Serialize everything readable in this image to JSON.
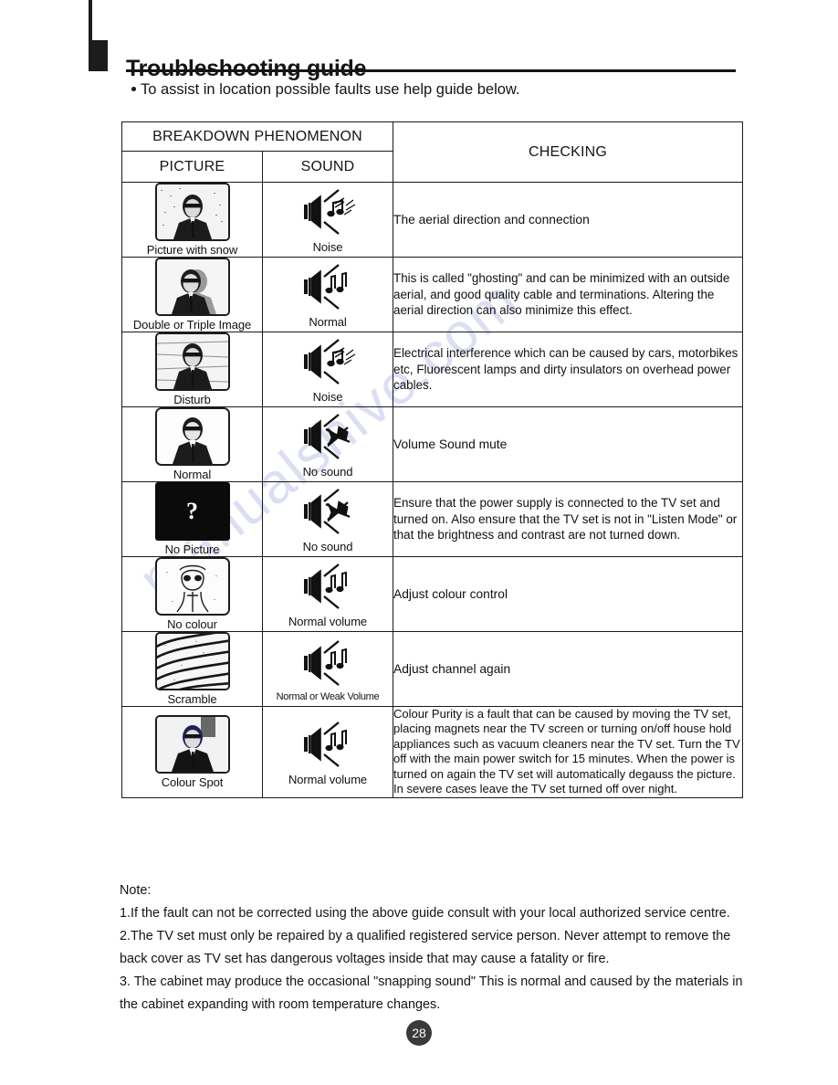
{
  "page": {
    "title": "Troubleshooting guide",
    "intro": "To assist in location possible faults use help guide below.",
    "number": "28",
    "watermark": "manualshive.com"
  },
  "table": {
    "group_header": "BREAKDOWN PHENOMENON",
    "columns": {
      "picture": "PICTURE",
      "sound": "SOUND",
      "checking": "CHECKING"
    },
    "rows": [
      {
        "picture_icon": "tv-snow-icon",
        "picture_label": "Picture with snow",
        "sound_icon": "speaker-noise-icon",
        "sound_label": "Noise",
        "checking": "The aerial direction and connection"
      },
      {
        "picture_icon": "tv-ghosting-icon",
        "picture_label": "Double or Triple Image",
        "sound_icon": "speaker-normal-icon",
        "sound_label": "Normal",
        "checking": "This is called \"ghosting\" and can be minimized with an outside aerial, and good quality cable and terminations.  Altering the aerial direction can also minimize this effect."
      },
      {
        "picture_icon": "tv-disturb-icon",
        "picture_label": "Disturb",
        "sound_icon": "speaker-noise-icon",
        "sound_label": "Noise",
        "checking": "Electrical interference which can be caused by cars, motorbikes etc, Fluorescent lamps and dirty insulators on overhead power cables."
      },
      {
        "picture_icon": "tv-normal-icon",
        "picture_label": "Normal",
        "sound_icon": "speaker-mute-icon",
        "sound_label": "No sound",
        "checking": "Volume Sound mute"
      },
      {
        "picture_icon": "tv-no-picture-icon",
        "picture_label": "No Picture",
        "sound_icon": "speaker-mute-icon",
        "sound_label": "No sound",
        "checking": "Ensure that the power supply is connected to the TV set and turned on. Also ensure that the TV set is not  in \"Listen Mode\" or that the  brightness and contrast are not turned down."
      },
      {
        "picture_icon": "tv-no-colour-icon",
        "picture_label": "No colour",
        "sound_icon": "speaker-normal-icon",
        "sound_label": "Normal volume",
        "checking": "Adjust colour control"
      },
      {
        "picture_icon": "tv-scramble-icon",
        "picture_label": "Scramble",
        "sound_icon": "speaker-normal-icon",
        "sound_label": "Normal or Weak Volume",
        "checking": "Adjust channel again"
      },
      {
        "picture_icon": "tv-colour-spot-icon",
        "picture_label": "Colour Spot",
        "sound_icon": "speaker-normal-icon",
        "sound_label": "Normal volume",
        "checking": "Colour Purity is a fault that can be caused by moving the TV set, placing magnets near the TV screen or turning on/off house hold appliances such as vacuum cleaners near the TV set. Turn the TV off with the main power switch for 15 minutes. When the power is turned on again the TV set will automatically degauss the picture. In severe cases leave the TV set turned off over night."
      }
    ]
  },
  "notes": {
    "heading": "Note:",
    "items": [
      "1.If the fault can not be corrected using the above guide consult with your local authorized service centre.",
      "2.The TV set must only be repaired by a qualified registered service person.  Never attempt to remove the back cover as TV set has dangerous voltages inside that may cause a fatality or fire.",
      "3. The cabinet may produce the occasional \"snapping sound\" This is normal and caused by the materials in the cabinet expanding with room temperature changes."
    ]
  },
  "colors": {
    "ink": "#141414",
    "rule": "#1a1a1a",
    "page_badge": "#3a3a3a",
    "watermark": "#8c96d2"
  }
}
